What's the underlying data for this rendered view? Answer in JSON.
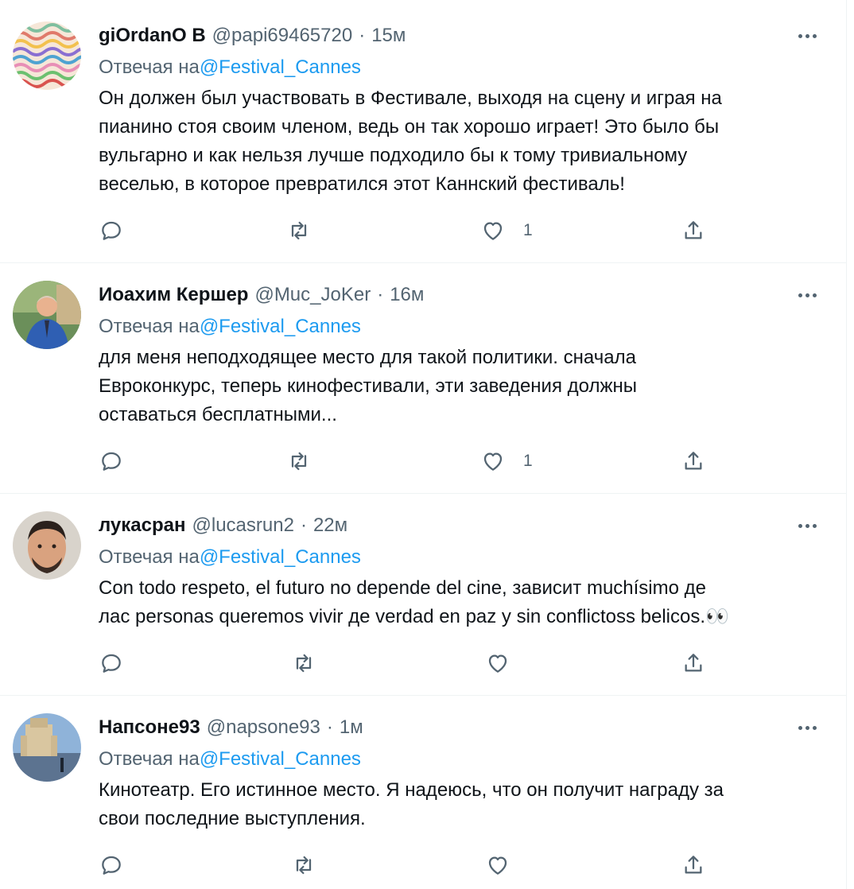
{
  "colors": {
    "text": "#0f1419",
    "secondary": "#536471",
    "link": "#1d9bf0",
    "divider": "#eff3f4"
  },
  "icons": {
    "reply": "reply-icon",
    "retweet": "retweet-icon",
    "like": "like-icon",
    "share": "share-icon",
    "more": "more-icon"
  },
  "tweets": [
    {
      "name": "giOrdanO B",
      "handle": "@papi69465720",
      "separator": "·",
      "time": "15м",
      "replying_prefix": "Отвечая на",
      "replying_to": "@Festival_Cannes",
      "text": "Он должен был участвовать в Фестивале, выходя на сцену и играя на\nпианино стоя своим членом, ведь он так хорошо играет! Это было бы\nвульгарно и как нельзя лучше подходило бы к тому тривиальному\nвеселью, в которое превратился этот Каннский фестиваль!",
      "likes": "1"
    },
    {
      "name": "Иоахим Кершер",
      "handle": "@Muc_JoKer",
      "separator": "·",
      "time": "16м",
      "replying_prefix": "Отвечая на",
      "replying_to": "@Festival_Cannes",
      "text": "для меня неподходящее место для такой политики. сначала\nЕвроконкурс, теперь кинофестивали, эти заведения должны\nоставаться бесплатными...",
      "likes": "1"
    },
    {
      "name": "лукасран",
      "handle": "@lucasrun2",
      "separator": "·",
      "time": "22м",
      "replying_prefix": "Отвечая на",
      "replying_to": "@Festival_Cannes",
      "text": "Con todo respeto, el futuro no depende del cine, зависит muchísimo де\nлас personas queremos vivir де verdad en paz y sin conflictoss belicos.👀",
      "likes": ""
    },
    {
      "name": "Напсоне93",
      "handle": "@napsone93",
      "separator": "·",
      "time": "1м",
      "replying_prefix": "Отвечая на",
      "replying_to": "@Festival_Cannes",
      "text": "Кинотеатр. Его истинное место. Я надеюсь, что он получит награду за\nсвои последние выступления.",
      "likes": ""
    }
  ]
}
